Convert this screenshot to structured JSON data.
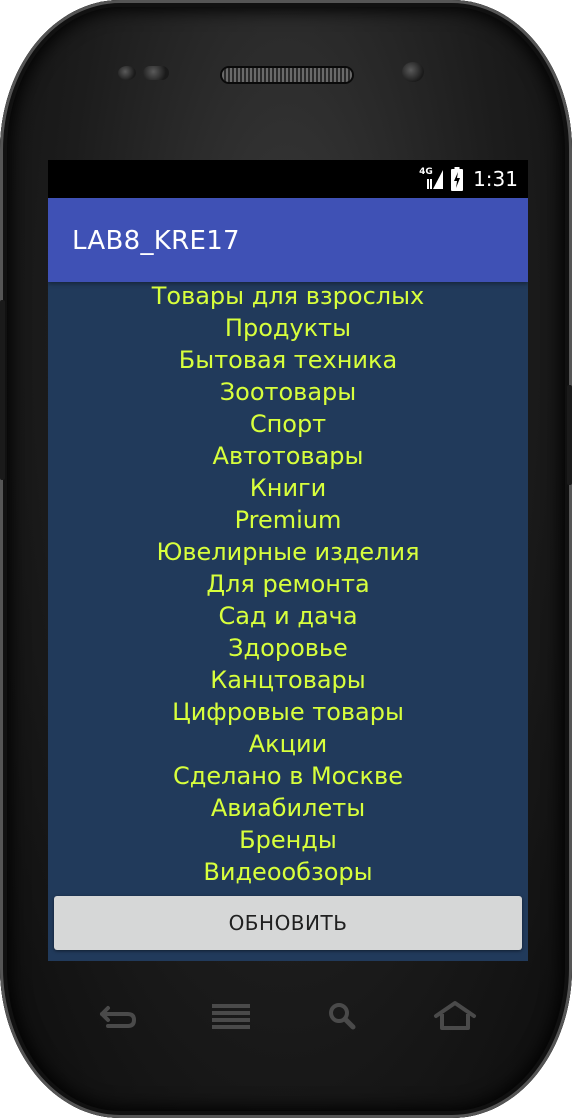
{
  "status_bar": {
    "network": "4G",
    "time": "1:31"
  },
  "app_bar": {
    "title": "LAB8_KRE17"
  },
  "categories": [
    "Товары для взрослых",
    "Продукты",
    "Бытовая техника",
    "Зоотовары",
    "Спорт",
    "Автотовары",
    "Книги",
    "Premium",
    "Ювелирные изделия",
    "Для ремонта",
    "Сад и дача",
    "Здоровье",
    "Канцтовары",
    "Цифровые товары",
    "Акции",
    "Сделано в Москве",
    "Авиабилеты",
    "Бренды",
    "Видеообзоры"
  ],
  "refresh_button": {
    "label": "ОБНОВИТЬ"
  },
  "colors": {
    "app_bar": "#3f51b5",
    "background": "#213a5b",
    "list_text": "#d8ff3c",
    "button": "#d6d7d7"
  },
  "nav_keys": [
    "back-icon",
    "menu-icon",
    "search-icon",
    "home-icon"
  ]
}
